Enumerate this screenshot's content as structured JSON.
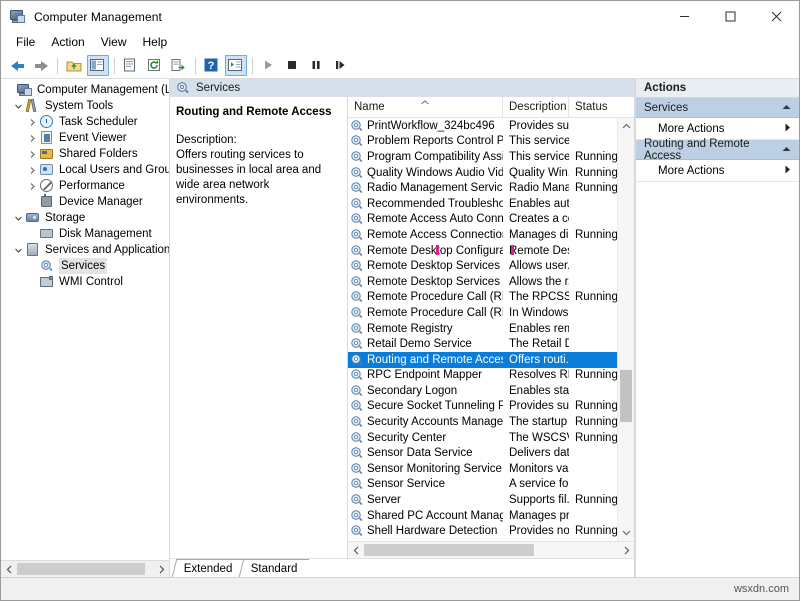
{
  "window": {
    "title": "Computer Management",
    "icon": "computer-management-icon",
    "controls": {
      "minimize": "─",
      "maximize": "□",
      "close": "✕"
    }
  },
  "menu": {
    "items": [
      "File",
      "Action",
      "View",
      "Help"
    ]
  },
  "toolbar": {
    "buttons": [
      {
        "name": "back-button",
        "icon": "arrow-left-icon",
        "selected": false
      },
      {
        "name": "forward-button",
        "icon": "arrow-right-icon",
        "selected": false
      },
      {
        "name": "up-one-level-button",
        "icon": "folder-up-icon",
        "selected": false
      },
      {
        "name": "show-hide-console-tree-button",
        "icon": "console-tree-icon",
        "selected": true
      },
      {
        "name": "properties-button",
        "icon": "properties-icon",
        "selected": false
      },
      {
        "name": "refresh-button",
        "icon": "refresh-icon",
        "selected": false
      },
      {
        "name": "export-list-button",
        "icon": "export-list-icon",
        "selected": false
      },
      {
        "name": "help-button",
        "icon": "help-icon",
        "selected": false
      },
      {
        "name": "show-hide-action-pane-button",
        "icon": "action-pane-icon",
        "selected": true
      },
      {
        "name": "start-service-button",
        "icon": "play-icon",
        "selected": false
      },
      {
        "name": "stop-service-button",
        "icon": "stop-icon",
        "selected": false
      },
      {
        "name": "pause-service-button",
        "icon": "pause-icon",
        "selected": false
      },
      {
        "name": "restart-service-button",
        "icon": "restart-icon",
        "selected": false
      }
    ]
  },
  "tree": {
    "nodes": [
      {
        "label": "Computer Management (Local",
        "indent": 0,
        "expander": "none",
        "icon": "computer-management-icon",
        "selected": false
      },
      {
        "label": "System Tools",
        "indent": 1,
        "expander": "expanded",
        "icon": "system-tools-icon",
        "selected": false
      },
      {
        "label": "Task Scheduler",
        "indent": 2,
        "expander": "collapsed",
        "icon": "task-scheduler-icon",
        "selected": false
      },
      {
        "label": "Event Viewer",
        "indent": 2,
        "expander": "collapsed",
        "icon": "event-viewer-icon",
        "selected": false
      },
      {
        "label": "Shared Folders",
        "indent": 2,
        "expander": "collapsed",
        "icon": "shared-folders-icon",
        "selected": false
      },
      {
        "label": "Local Users and Groups",
        "indent": 2,
        "expander": "collapsed",
        "icon": "local-users-groups-icon",
        "selected": false
      },
      {
        "label": "Performance",
        "indent": 2,
        "expander": "collapsed",
        "icon": "performance-icon",
        "selected": false
      },
      {
        "label": "Device Manager",
        "indent": 2,
        "expander": "none",
        "icon": "device-manager-icon",
        "selected": false
      },
      {
        "label": "Storage",
        "indent": 1,
        "expander": "expanded",
        "icon": "storage-icon",
        "selected": false
      },
      {
        "label": "Disk Management",
        "indent": 2,
        "expander": "none",
        "icon": "disk-management-icon",
        "selected": false
      },
      {
        "label": "Services and Applications",
        "indent": 1,
        "expander": "expanded",
        "icon": "services-applications-icon",
        "selected": false
      },
      {
        "label": "Services",
        "indent": 2,
        "expander": "none",
        "icon": "services-gear-icon",
        "selected": true
      },
      {
        "label": "WMI Control",
        "indent": 2,
        "expander": "none",
        "icon": "wmi-control-icon",
        "selected": false
      }
    ]
  },
  "center": {
    "pane_header": {
      "label": "Services",
      "icon": "services-gear-icon"
    },
    "detail": {
      "service_title": "Routing and Remote Access",
      "description_label": "Description:",
      "description_body": "Offers routing services to businesses in local area and wide area network environments."
    },
    "columns": [
      {
        "key": "name",
        "label": "Name",
        "sort": "asc"
      },
      {
        "key": "desc",
        "label": "Description",
        "sort": "none"
      },
      {
        "key": "status",
        "label": "Status",
        "sort": "none"
      }
    ],
    "rows": [
      {
        "name": "PrintWorkflow_324bc496",
        "desc": "Provides su...",
        "status": "",
        "selected": false
      },
      {
        "name": "Problem Reports Control Pa...",
        "desc": "This service ...",
        "status": "",
        "selected": false
      },
      {
        "name": "Program Compatibility Assi...",
        "desc": "This service ...",
        "status": "Running",
        "selected": false
      },
      {
        "name": "Quality Windows Audio Vid...",
        "desc": "Quality Win...",
        "status": "Running",
        "selected": false
      },
      {
        "name": "Radio Management Service",
        "desc": "Radio Mana...",
        "status": "Running",
        "selected": false
      },
      {
        "name": "Recommended Troublesho...",
        "desc": "Enables aut...",
        "status": "",
        "selected": false
      },
      {
        "name": "Remote Access Auto Conne...",
        "desc": "Creates a co...",
        "status": "",
        "selected": false
      },
      {
        "name": "Remote Access Connection...",
        "desc": "Manages di...",
        "status": "Running",
        "selected": false
      },
      {
        "name": "Remote Desktop Configurat...",
        "desc": "Remote Des...",
        "status": "",
        "selected": false
      },
      {
        "name": "Remote Desktop Services",
        "desc": "Allows user...",
        "status": "",
        "selected": false
      },
      {
        "name": "Remote Desktop Services U...",
        "desc": "Allows the r...",
        "status": "",
        "selected": false
      },
      {
        "name": "Remote Procedure Call (RPC)",
        "desc": "The RPCSS s...",
        "status": "Running",
        "selected": false
      },
      {
        "name": "Remote Procedure Call (RP...",
        "desc": "In Windows...",
        "status": "",
        "selected": false
      },
      {
        "name": "Remote Registry",
        "desc": "Enables rem...",
        "status": "",
        "selected": false
      },
      {
        "name": "Retail Demo Service",
        "desc": "The Retail D...",
        "status": "",
        "selected": false
      },
      {
        "name": "Routing and Remote Access",
        "desc": "Offers routi...",
        "status": "",
        "selected": true
      },
      {
        "name": "RPC Endpoint Mapper",
        "desc": "Resolves RP...",
        "status": "Running",
        "selected": false
      },
      {
        "name": "Secondary Logon",
        "desc": "Enables star...",
        "status": "",
        "selected": false
      },
      {
        "name": "Secure Socket Tunneling Pr...",
        "desc": "Provides su...",
        "status": "Running",
        "selected": false
      },
      {
        "name": "Security Accounts Manager",
        "desc": "The startup ...",
        "status": "Running",
        "selected": false
      },
      {
        "name": "Security Center",
        "desc": "The WSCSV...",
        "status": "Running",
        "selected": false
      },
      {
        "name": "Sensor Data Service",
        "desc": "Delivers dat...",
        "status": "",
        "selected": false
      },
      {
        "name": "Sensor Monitoring Service",
        "desc": "Monitors va...",
        "status": "",
        "selected": false
      },
      {
        "name": "Sensor Service",
        "desc": "A service fo...",
        "status": "",
        "selected": false
      },
      {
        "name": "Server",
        "desc": "Supports fil...",
        "status": "Running",
        "selected": false
      },
      {
        "name": "Shared PC Account Manager",
        "desc": "Manages pr...",
        "status": "",
        "selected": false
      },
      {
        "name": "Shell Hardware Detection",
        "desc": "Provides no...",
        "status": "Running",
        "selected": false
      }
    ],
    "tabs": [
      {
        "label": "Extended",
        "active": false
      },
      {
        "label": "Standard",
        "active": true
      }
    ]
  },
  "actions": {
    "title": "Actions",
    "sections": [
      {
        "label": "Services",
        "collapse_icon": "caret-up-icon",
        "items": [
          {
            "label": "More Actions",
            "submenu_icon": "caret-right-icon"
          }
        ]
      },
      {
        "label": "Routing and Remote Access",
        "collapse_icon": "caret-up-icon",
        "items": [
          {
            "label": "More Actions",
            "submenu_icon": "caret-right-icon"
          }
        ]
      }
    ]
  },
  "statusbar": {
    "watermark": "wsxdn.com"
  },
  "colors": {
    "selection_blue": "#0a7cda",
    "actions_section": "#bdd0e3",
    "pane_header": "#d6e0ea",
    "toolbar_selected": "#cde2f7",
    "caret_artifact": "#e0218a"
  }
}
